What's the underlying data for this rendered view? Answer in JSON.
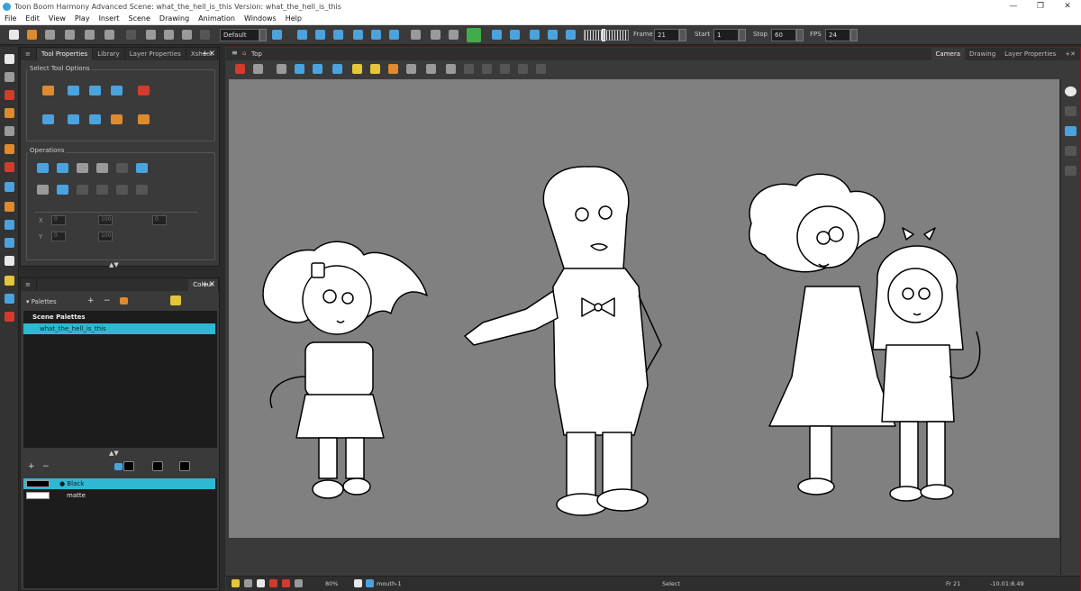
{
  "window": {
    "title": "Toon Boom Harmony Advanced Scene: what_the_hell_is_this Version: what_the_hell_is_this",
    "minimize": "—",
    "maximize": "❐",
    "close": "✕"
  },
  "menu": [
    "File",
    "Edit",
    "View",
    "Play",
    "Insert",
    "Scene",
    "Drawing",
    "Animation",
    "Windows",
    "Help"
  ],
  "toolbar": {
    "workspace": "Default",
    "frame_label": "Frame",
    "frame_value": "21",
    "start_label": "Start",
    "start_value": "1",
    "stop_label": "Stop",
    "stop_value": "60",
    "fps_label": "FPS",
    "fps_value": "24"
  },
  "tool_panel": {
    "tabs": [
      "Tool Properties",
      "Library",
      "Layer Properties",
      "Xsheet"
    ],
    "active_tab": "Tool Properties",
    "select_options_title": "Select Tool Options",
    "operations_title": "Operations",
    "fields": {
      "x": "0",
      "y": "0",
      "w": "100",
      "h": "100",
      "angle": "0"
    }
  },
  "colour_panel": {
    "title": "Colour",
    "palettes_label": "Palettes",
    "scene_palettes_label": "Scene Palettes",
    "palette_name": "what_the_hell_is_this",
    "swatches": [
      {
        "name": "Black",
        "color": "#000000",
        "selected": true
      },
      {
        "name": "matte",
        "color": "#ffffff",
        "selected": false
      }
    ]
  },
  "view": {
    "tabs": [
      "Camera",
      "Drawing",
      "Layer Properties"
    ],
    "active_tab": "Camera",
    "view_label": "Top",
    "zoom": "80%",
    "layer": "mouth-1",
    "tool_status": "Select",
    "frame_status": "Fr 21",
    "coords": "-10.01:8.49"
  },
  "colors": {
    "canvas_bg": "#808080",
    "selection": "#2fb8d2",
    "frame_border": "#7a1a1a"
  }
}
